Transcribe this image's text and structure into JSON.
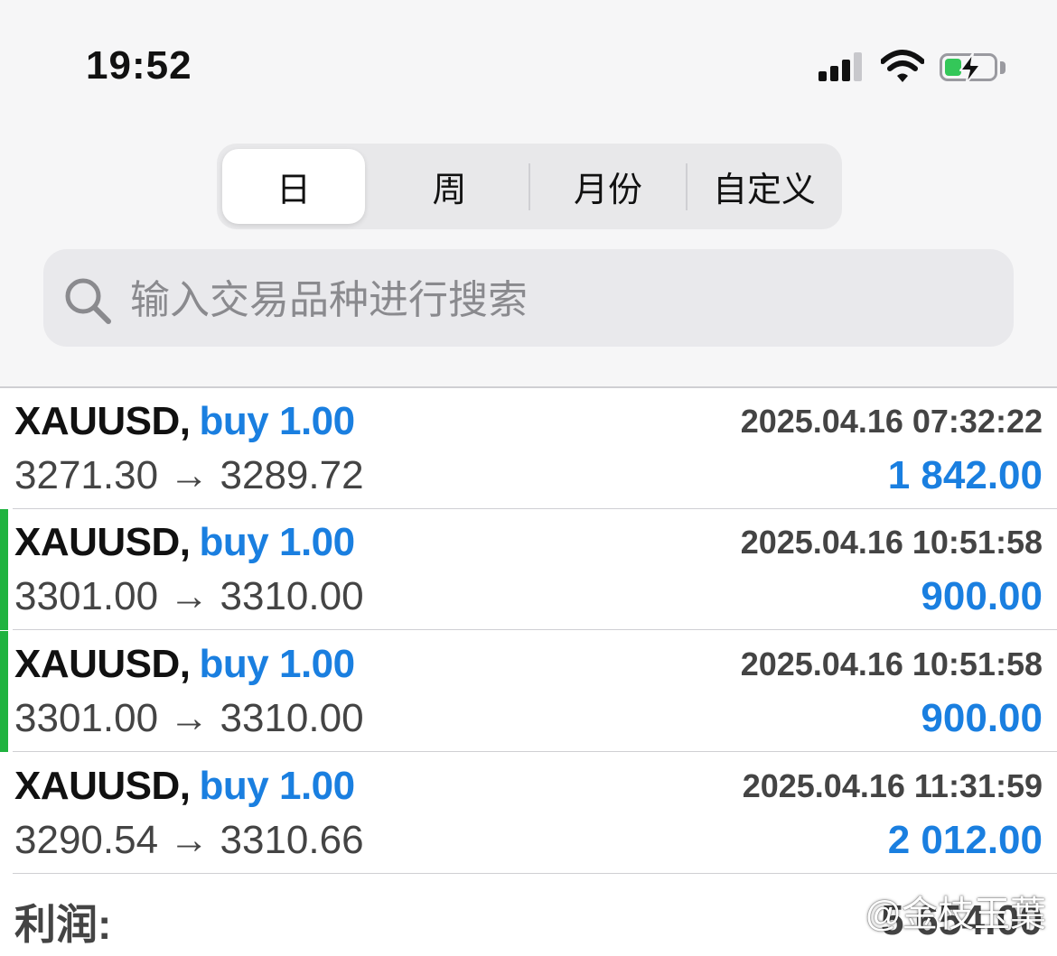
{
  "status_bar": {
    "time": "19:52",
    "icons": [
      "cellular-signal-icon",
      "wifi-icon",
      "battery-charging-icon"
    ]
  },
  "period_tabs": [
    {
      "label": "日",
      "selected": true
    },
    {
      "label": "周",
      "selected": false
    },
    {
      "label": "月份",
      "selected": false
    },
    {
      "label": "自定义",
      "selected": false
    }
  ],
  "search": {
    "placeholder": "输入交易品种进行搜索",
    "icon": "search-icon"
  },
  "trades": [
    {
      "symbol": "XAUUSD,",
      "action": "buy 1.00",
      "datetime": "2025.04.16 07:32:22",
      "prices": "3271.30 → 3289.72",
      "profit": "1 842.00",
      "indicator": false
    },
    {
      "symbol": "XAUUSD,",
      "action": "buy 1.00",
      "datetime": "2025.04.16 10:51:58",
      "prices": "3301.00 → 3310.00",
      "profit": "900.00",
      "indicator": true
    },
    {
      "symbol": "XAUUSD,",
      "action": "buy 1.00",
      "datetime": "2025.04.16 10:51:58",
      "prices": "3301.00 → 3310.00",
      "profit": "900.00",
      "indicator": true
    },
    {
      "symbol": "XAUUSD,",
      "action": "buy 1.00",
      "datetime": "2025.04.16 11:31:59",
      "prices": "3290.54 → 3310.66",
      "profit": "2 012.00",
      "indicator": false
    }
  ],
  "summary": {
    "label": "利润:",
    "value": "5 654.00"
  },
  "watermark": "@金枝玉葉",
  "colors": {
    "accent_blue": "#1a7fe0",
    "indicator_green": "#1fb33f",
    "battery_green": "#34c759"
  }
}
